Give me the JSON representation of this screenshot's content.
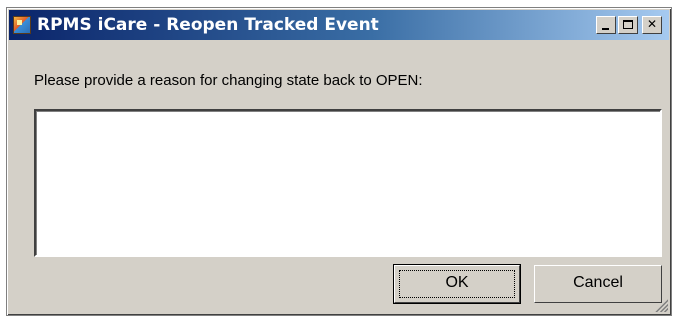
{
  "window": {
    "title": "RPMS iCare - Reopen Tracked Event",
    "app_icon": "icare-app-icon",
    "controls": {
      "minimize_icon": "minimize-icon",
      "maximize_icon": "maximize-icon",
      "close_icon": "close-icon",
      "close_glyph": "✕"
    }
  },
  "dialog": {
    "prompt": "Please provide a reason for changing state back to OPEN:",
    "reason_value": "",
    "ok_label": "OK",
    "cancel_label": "Cancel"
  },
  "colors": {
    "face": "#d4d0c8",
    "title_start": "#0a246a",
    "title_end": "#a6caf0"
  }
}
